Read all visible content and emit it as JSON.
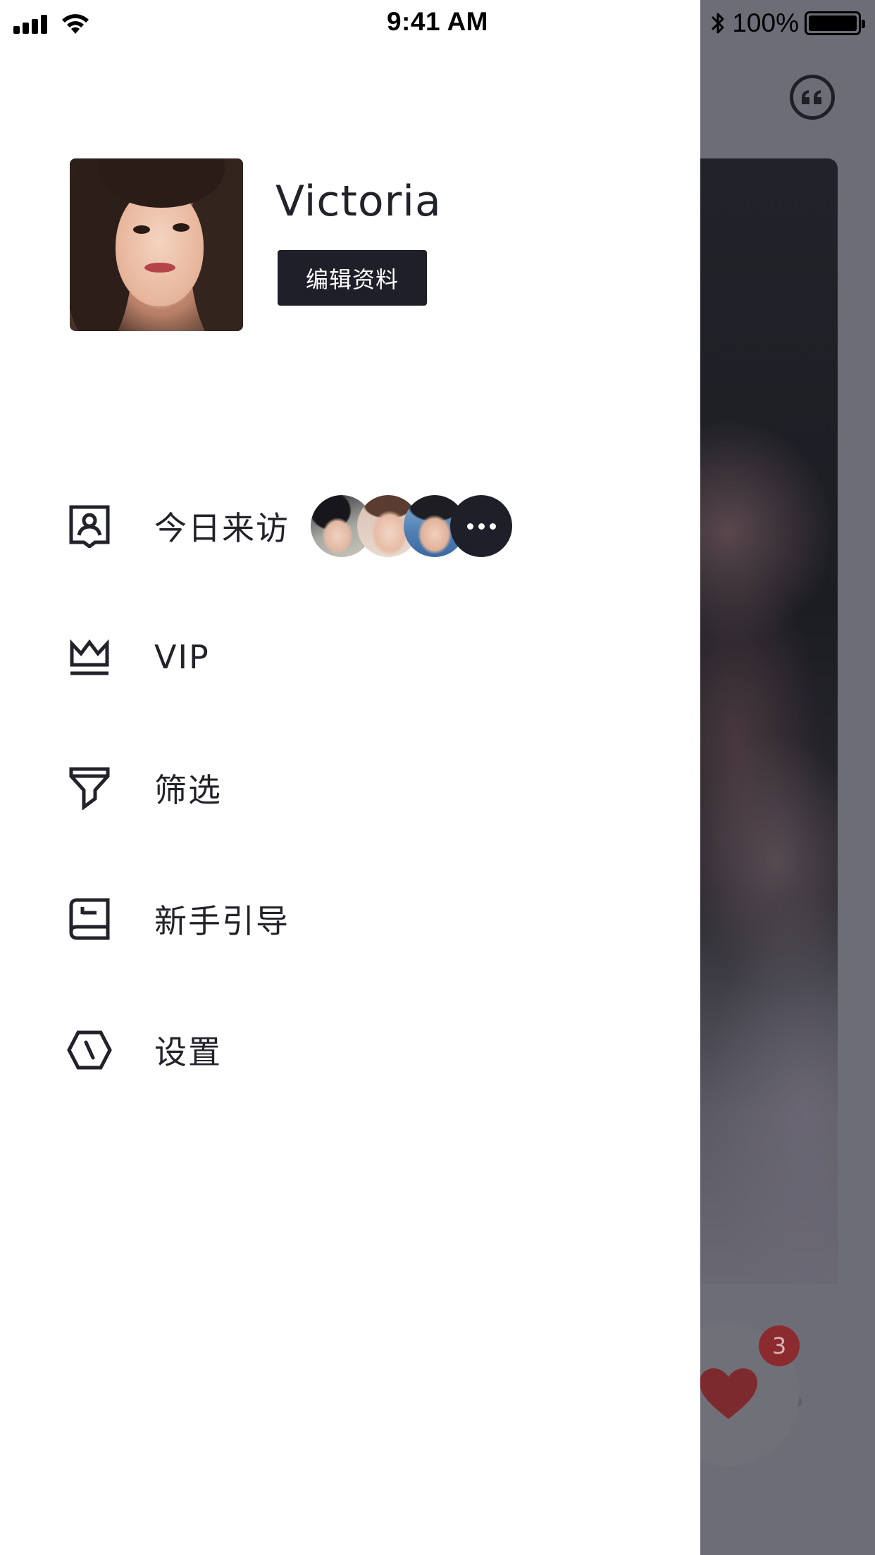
{
  "status_bar": {
    "time": "9:41 AM",
    "battery_percent": "100%"
  },
  "profile": {
    "name": "Victoria",
    "edit_button_label": "编辑资料"
  },
  "menu": {
    "items": [
      {
        "label": "今日来访",
        "icon": "visitor-id-icon"
      },
      {
        "label": "VIP",
        "icon": "crown-icon"
      },
      {
        "label": "筛选",
        "icon": "filter-icon"
      },
      {
        "label": "新手引导",
        "icon": "guide-book-icon"
      },
      {
        "label": "设置",
        "icon": "settings-hexagon-icon"
      }
    ]
  },
  "background_app": {
    "like_badge_count": "3",
    "carousel_page_count": 4,
    "carousel_active_index": 0
  },
  "colors": {
    "primary_dark": "#1f1f29",
    "text": "#22222a",
    "overlay": "#6d6d78",
    "like_red": "#8b2a2f"
  }
}
